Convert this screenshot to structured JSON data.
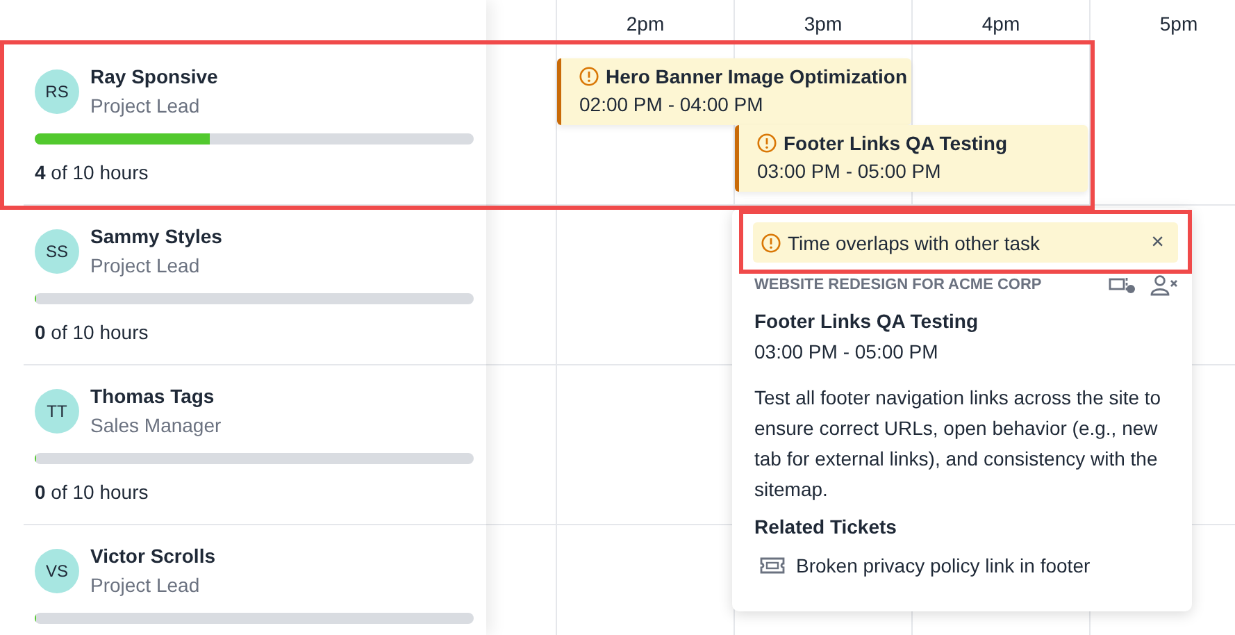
{
  "timeline": {
    "hours": [
      "2pm",
      "3pm",
      "4pm",
      "5pm"
    ]
  },
  "people": [
    {
      "initials": "RS",
      "name": "Ray Sponsive",
      "role": "Project Lead",
      "level": 0.4,
      "hours": "**4** of 10 hours"
    },
    {
      "initials": "SS",
      "name": "Sammy Styles",
      "role": "Project Lead",
      "level": 0,
      "hours": "**0** of 10 hours"
    },
    {
      "initials": "TT",
      "name": "Thomas Tags",
      "role": "Sales Manager",
      "level": 0,
      "hours": "**0** of 10 hours"
    },
    {
      "initials": "VS",
      "name": "Victor Scrolls",
      "role": "Project Lead",
      "level": 0
    }
  ],
  "tasks": [
    {
      "title": "Hero Banner Image Optimization",
      "time": "02:00 PM - 04:00 PM",
      "warning": true
    },
    {
      "title": "Footer Links QA Testing",
      "time": "03:00 PM - 05:00 PM",
      "warning": true
    }
  ],
  "popover": {
    "alert": "Time overlaps with other task",
    "close": "×",
    "project": "WEBSITE REDESIGN FOR ACME CORP",
    "title": "Footer Links QA Testing",
    "time": "03:00 PM - 05:00 PM",
    "description": "Test all footer navigation links across the site to ensure correct URLs, open behavior (e.g., new tab for external links), and consistency with the sitemap.",
    "related_heading": "Related Tickets",
    "tickets": [
      "Broken privacy policy link in footer"
    ]
  }
}
